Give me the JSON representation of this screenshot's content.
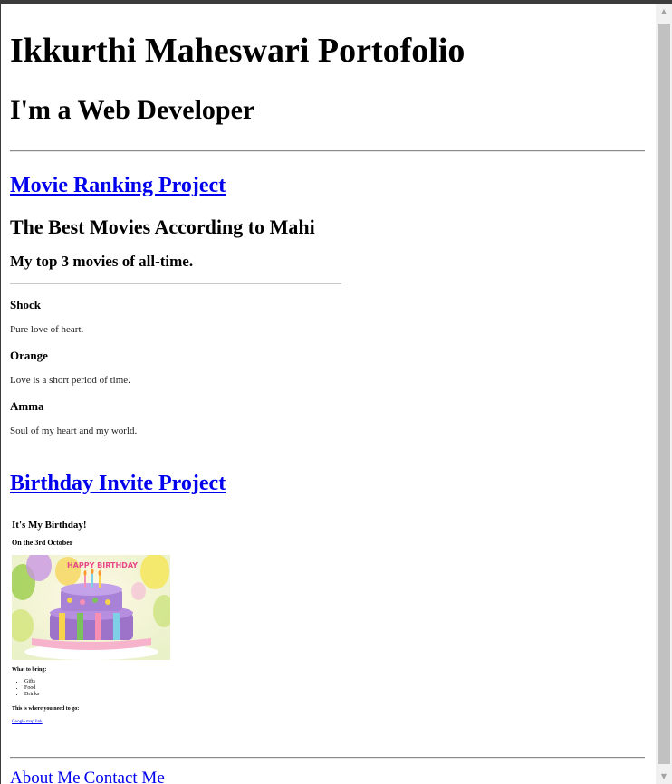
{
  "header": {
    "title": "Ikkurthi Maheswari Portofolio",
    "subtitle": "I'm a Web Developer"
  },
  "movie_project": {
    "link_label": "Movie Ranking Project",
    "heading": "The Best Movies According to Mahi",
    "subheading": "My top 3 movies of all-time.",
    "movies": [
      {
        "title": "Shock",
        "description": "Pure love of heart."
      },
      {
        "title": "Orange",
        "description": "Love is a short period of time."
      },
      {
        "title": "Amma",
        "description": "Soul of my heart and my world."
      }
    ]
  },
  "birthday_project": {
    "link_label": "Birthday Invite Project",
    "heading": "It's My Birthday!",
    "date": "On the 3rd October",
    "image_sign": "HAPPY BIRTHDAY",
    "bring_label": "What to bring:",
    "bring_items": [
      "Gifts",
      "Food",
      "Drinks"
    ],
    "where_label": "This is where you need to go:",
    "map_link": "Google map link"
  },
  "footer": {
    "about_label": "About Me",
    "contact_label": "Contact Me"
  },
  "colors": {
    "link": "#0000ee",
    "scrollbar_thumb": "#c1c1c1"
  }
}
